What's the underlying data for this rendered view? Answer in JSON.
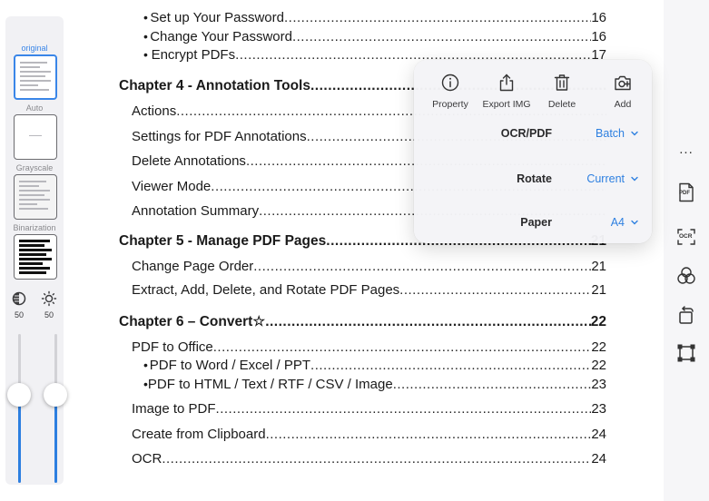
{
  "sidebar": {
    "filters": [
      {
        "label": "original",
        "active": true
      },
      {
        "label": "Auto",
        "active": false
      },
      {
        "label": "Grayscale",
        "active": false
      },
      {
        "label": "Binarization",
        "active": false
      }
    ],
    "contrast_value": "50",
    "brightness_value": "50",
    "contrast_level": 0.5,
    "brightness_level": 0.5
  },
  "document": {
    "lines": [
      {
        "kind": "bul",
        "text": "Set up Your Password",
        "page": "16"
      },
      {
        "kind": "bul",
        "text": "Change Your Password",
        "page": "16"
      },
      {
        "kind": "bul",
        "text": "Encrypt PDFs",
        "page": "17"
      },
      {
        "kind": "chap",
        "text": "Chapter 4 - Annotation Tools",
        "page": ""
      },
      {
        "kind": "sub",
        "text": "Actions",
        "page": ""
      },
      {
        "kind": "sub",
        "text": "Settings for PDF Annotations",
        "page": ""
      },
      {
        "kind": "sub",
        "text": "Delete Annotations",
        "page": ""
      },
      {
        "kind": "sub",
        "text": "Viewer Mode",
        "page": ""
      },
      {
        "kind": "sub",
        "text": "Annotation Summary",
        "page": ""
      },
      {
        "kind": "chap",
        "text": "Chapter 5 - Manage PDF Pages",
        "page": "21"
      },
      {
        "kind": "sub",
        "text": "Change Page Order",
        "page": "21"
      },
      {
        "kind": "sub",
        "text": "Extract, Add, Delete, and Rotate PDF Pages",
        "page": "21"
      },
      {
        "kind": "chap",
        "text": "Chapter 6 – Convert☆",
        "page": "22"
      },
      {
        "kind": "sub",
        "text": "PDF to Office",
        "page": "22"
      },
      {
        "kind": "bul",
        "text": "PDF to Word / Excel / PPT",
        "page": "22"
      },
      {
        "kind": "bul",
        "text": "PDF to HTML / Text / RTF / CSV / Image",
        "page": "23"
      },
      {
        "kind": "sub",
        "text": "Image to PDF",
        "page": "23"
      },
      {
        "kind": "sub",
        "text": "Create from Clipboard",
        "page": "24"
      },
      {
        "kind": "sub",
        "text": "OCR",
        "page": "24"
      }
    ]
  },
  "popup": {
    "actions": [
      {
        "label": "Property",
        "icon": "info-icon"
      },
      {
        "label": "Export IMG",
        "icon": "share-icon"
      },
      {
        "label": "Delete",
        "icon": "trash-icon"
      },
      {
        "label": "Add",
        "icon": "add-photo-icon"
      }
    ],
    "settings": [
      {
        "name": "OCR/PDF",
        "value": "Batch"
      },
      {
        "name": "Rotate",
        "value": "Current"
      },
      {
        "name": "Paper",
        "value": "A4"
      }
    ]
  },
  "rightbar": {
    "more": "...",
    "pdf_label": "PDF",
    "ocr_label": "OCR",
    "icons": [
      "more-icon",
      "pdf-icon",
      "ocr-icon",
      "color-circles-icon",
      "rotate-icon",
      "crop-icon"
    ]
  },
  "colors": {
    "accent": "#2d7fe0",
    "text": "#1a1a1a",
    "sidebar_bg": "#f1f1f4"
  }
}
